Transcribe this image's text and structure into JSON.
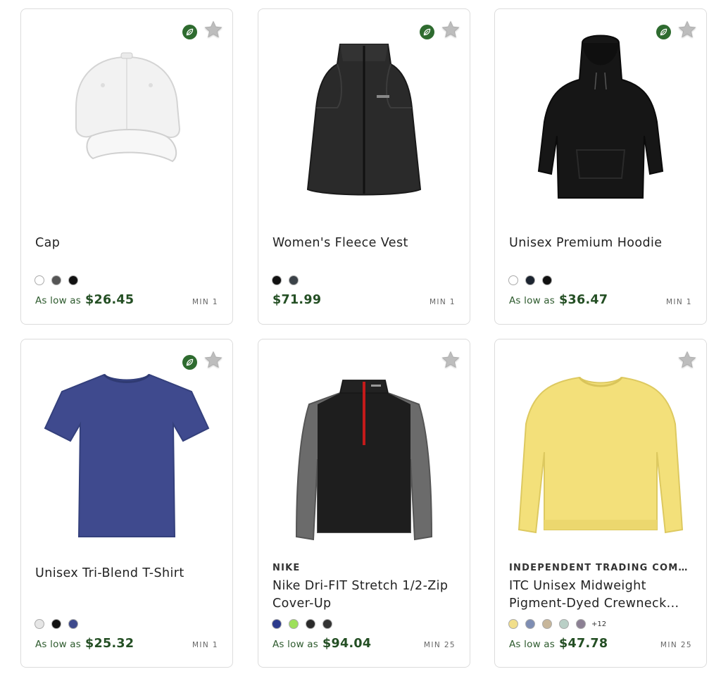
{
  "products": [
    {
      "brand": "",
      "name": "Cap",
      "eco": true,
      "image": "white-cap",
      "swatches": [
        "#ffffff",
        "#555555",
        "#111111"
      ],
      "more_colors": "",
      "price_prefix": "As low as",
      "price": "$26.45",
      "min": "MIN 1"
    },
    {
      "brand": "",
      "name": "Women's Fleece Vest",
      "eco": true,
      "image": "black-fleece-vest",
      "swatches": [
        "#111111",
        "#3b4248"
      ],
      "more_colors": "",
      "price_prefix": "",
      "price": "$71.99",
      "min": "MIN 1"
    },
    {
      "brand": "",
      "name": "Unisex Premium Hoodie",
      "eco": true,
      "image": "black-hoodie",
      "swatches": [
        "#ffffff",
        "#1c2430",
        "#111111"
      ],
      "more_colors": "",
      "price_prefix": "As low as",
      "price": "$36.47",
      "min": "MIN 1"
    },
    {
      "brand": "",
      "name": "Unisex Tri-Blend T-Shirt",
      "eco": true,
      "image": "navy-tshirt",
      "swatches": [
        "#e6e6e6",
        "#111111",
        "#3e4a8c"
      ],
      "more_colors": "",
      "price_prefix": "As low as",
      "price": "$25.32",
      "min": "MIN 1"
    },
    {
      "brand": "NIKE",
      "name": "Nike Dri-FIT Stretch 1/2-Zip Cover-Up",
      "eco": false,
      "image": "black-grey-half-zip",
      "swatches": [
        "#2b3a8c",
        "#9de05a",
        "#2a2a2a",
        "#333333"
      ],
      "more_colors": "",
      "price_prefix": "As low as",
      "price": "$94.04",
      "min": "MIN 25"
    },
    {
      "brand": "INDEPENDENT TRADING COMP...",
      "name": "ITC Unisex Midweight Pigment-Dyed Crewneck...",
      "eco": false,
      "image": "yellow-crewneck",
      "swatches": [
        "#f1de8a",
        "#7e8db3",
        "#c7b69a",
        "#b9cfc6",
        "#8c8094"
      ],
      "more_colors": "+12",
      "price_prefix": "As low as",
      "price": "$47.78",
      "min": "MIN 25"
    }
  ],
  "icons": {
    "eco": "leaf-icon",
    "favorite": "star-icon"
  },
  "colors": {
    "price_green": "#244f24",
    "eco_badge": "#2e6b2f",
    "card_border": "#dcdcdc"
  }
}
